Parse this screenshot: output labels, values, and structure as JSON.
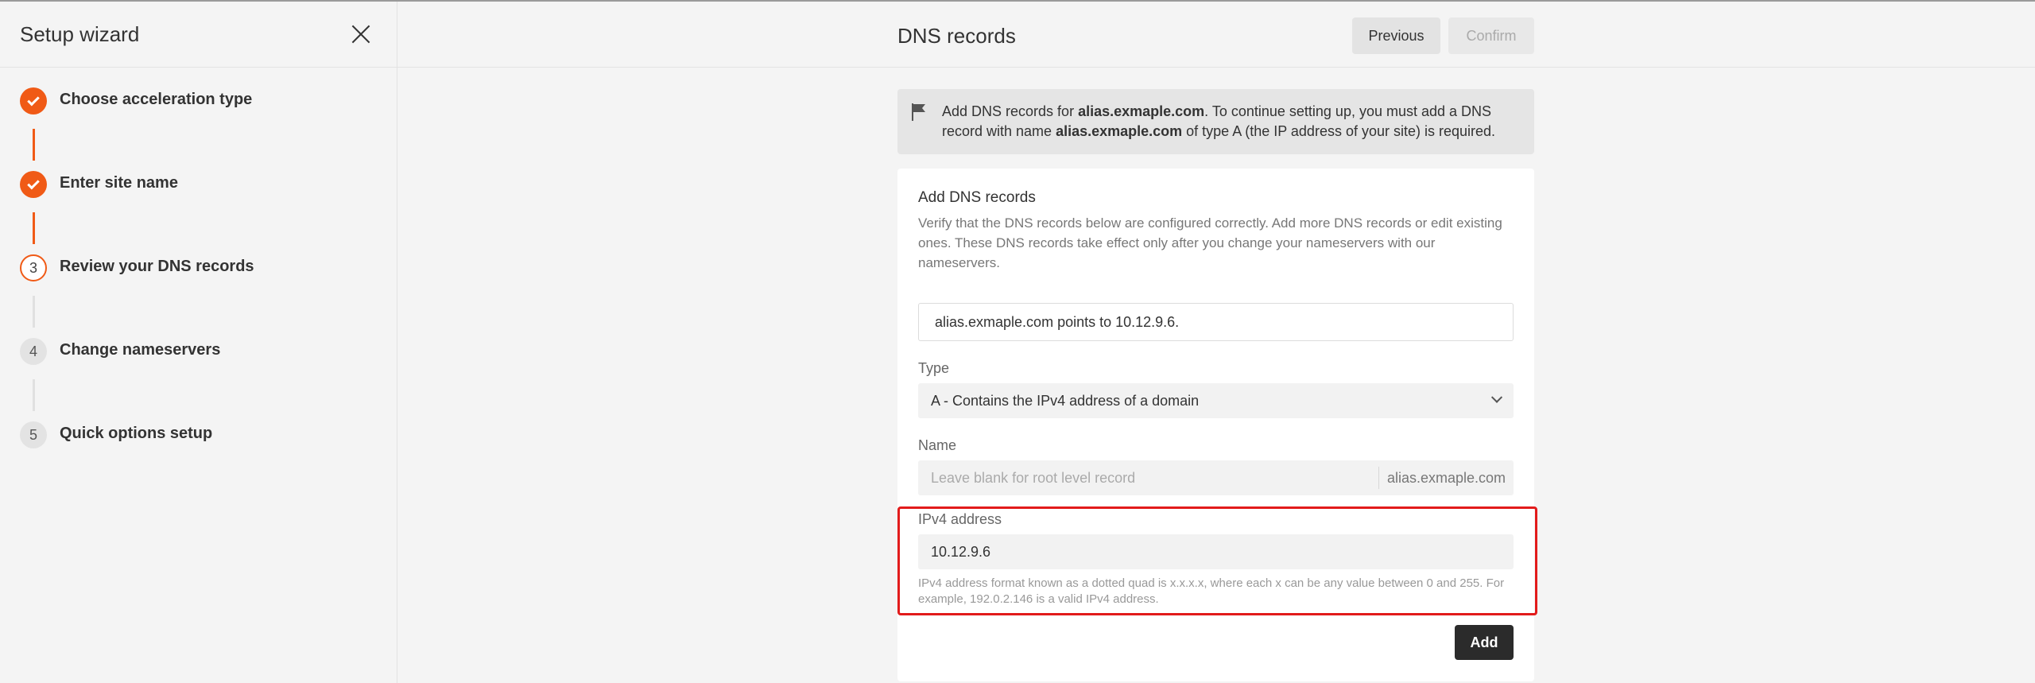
{
  "sidebar": {
    "title": "Setup wizard",
    "steps": [
      {
        "number": "1",
        "label": "Choose acceleration type",
        "status": "done"
      },
      {
        "number": "2",
        "label": "Enter site name",
        "status": "done"
      },
      {
        "number": "3",
        "label": "Review your DNS records",
        "status": "current"
      },
      {
        "number": "4",
        "label": "Change nameservers",
        "status": "pending"
      },
      {
        "number": "5",
        "label": "Quick options setup",
        "status": "pending"
      }
    ]
  },
  "header": {
    "title": "DNS records",
    "previous_label": "Previous",
    "confirm_label": "Confirm"
  },
  "notice": {
    "text_1": "Add DNS records for ",
    "domain_1": "alias.exmaple.com",
    "text_2": ". To continue setting up, you must add a DNS record with name ",
    "domain_2": "alias.exmaple.com",
    "text_3": " of type A (the IP address of your site) is required."
  },
  "form": {
    "title": "Add DNS records",
    "description": "Verify that the DNS records below are configured correctly. Add more DNS records or edit existing ones. These DNS records take effect only after you change your nameservers with our nameservers.",
    "info": "alias.exmaple.com points to 10.12.9.6.",
    "type_label": "Type",
    "type_value": "A - Contains the IPv4 address of a domain",
    "name_label": "Name",
    "name_placeholder": "Leave blank for root level record",
    "name_suffix": "alias.exmaple.com",
    "ipv4_label": "IPv4 address",
    "ipv4_value": "10.12.9.6",
    "ipv4_hint": "IPv4 address format known as a dotted quad is x.x.x.x, where each x can be any value between 0 and 255. For example, 192.0.2.146 is a valid IPv4 address.",
    "add_label": "Add"
  },
  "colors": {
    "accent": "#f05a16",
    "highlight": "#e21b1b"
  },
  "icons": {
    "close": "close-icon",
    "check": "check-icon",
    "flag": "flag-icon",
    "chevron": "chevron-down-icon"
  }
}
